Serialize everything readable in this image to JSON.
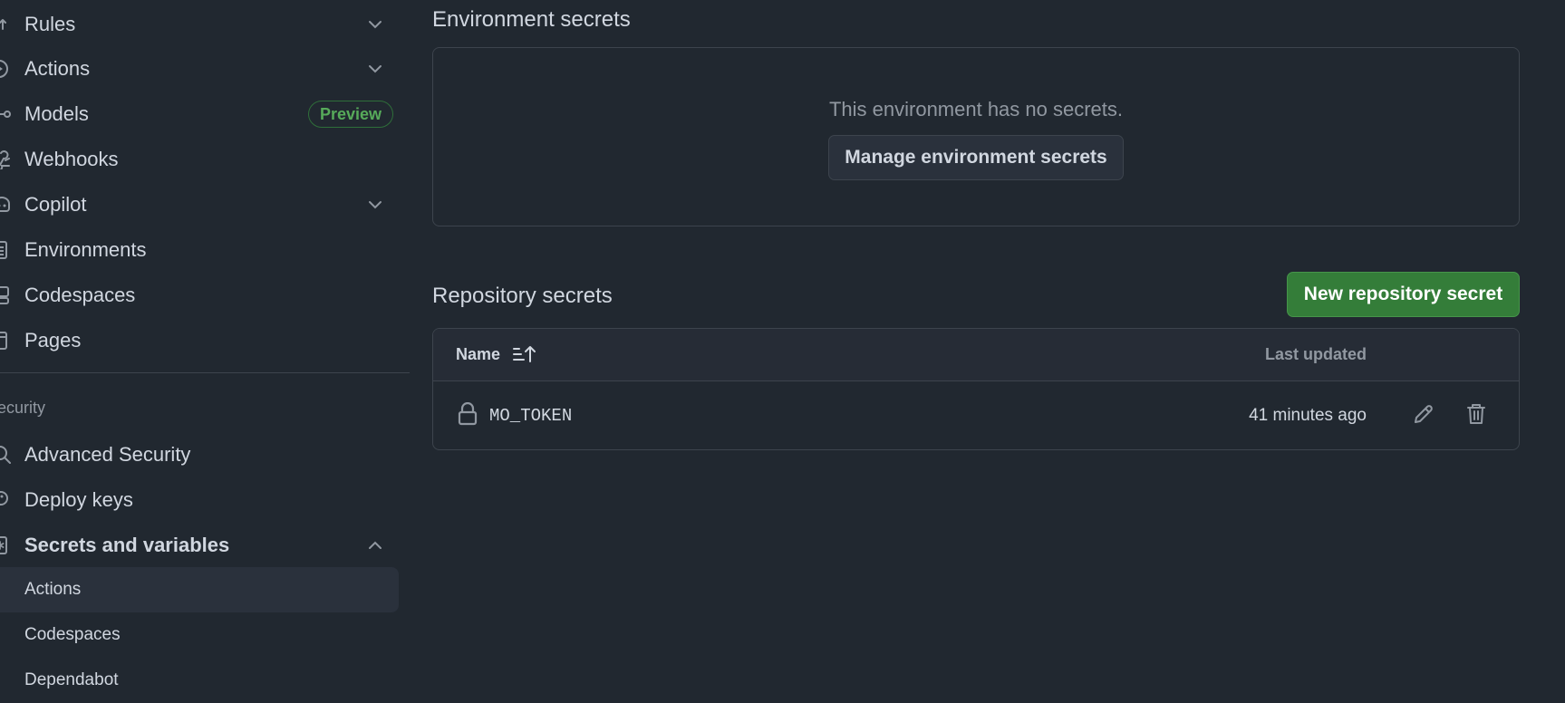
{
  "sidebar": {
    "items": [
      {
        "label": "Rules",
        "icon": "rules-icon",
        "chevron": "down"
      },
      {
        "label": "Actions",
        "icon": "play-icon",
        "chevron": "down"
      },
      {
        "label": "Models",
        "icon": "models-icon",
        "badge": "Preview"
      },
      {
        "label": "Webhooks",
        "icon": "webhook-icon"
      },
      {
        "label": "Copilot",
        "icon": "copilot-icon",
        "chevron": "down"
      },
      {
        "label": "Environments",
        "icon": "server-icon"
      },
      {
        "label": "Codespaces",
        "icon": "codespaces-icon"
      },
      {
        "label": "Pages",
        "icon": "browser-icon"
      }
    ],
    "security_heading": "ecurity",
    "security_items": [
      {
        "label": "Advanced Security",
        "icon": "codescan-icon"
      },
      {
        "label": "Deploy keys",
        "icon": "key-icon"
      },
      {
        "label": "Secrets and variables",
        "icon": "asterisk-icon",
        "chevron": "up",
        "expanded": true
      }
    ],
    "sub_items": [
      {
        "label": "Actions",
        "active": true
      },
      {
        "label": "Codespaces",
        "active": false
      },
      {
        "label": "Dependabot",
        "active": false
      }
    ]
  },
  "main": {
    "environment_secrets": {
      "title": "Environment secrets",
      "empty_text": "This environment has no secrets.",
      "manage_button": "Manage environment secrets"
    },
    "repository_secrets": {
      "title": "Repository secrets",
      "new_button": "New repository secret",
      "table": {
        "col_name": "Name",
        "col_updated": "Last updated",
        "rows": [
          {
            "name": "MO_TOKEN",
            "updated": "41 minutes ago"
          }
        ]
      }
    }
  },
  "colors": {
    "background": "#212830",
    "border": "#3d444d",
    "primary_button": "#347d39",
    "badge_green": "#57ab5a",
    "text": "#d1d7e0",
    "muted_text": "#9198a1"
  }
}
